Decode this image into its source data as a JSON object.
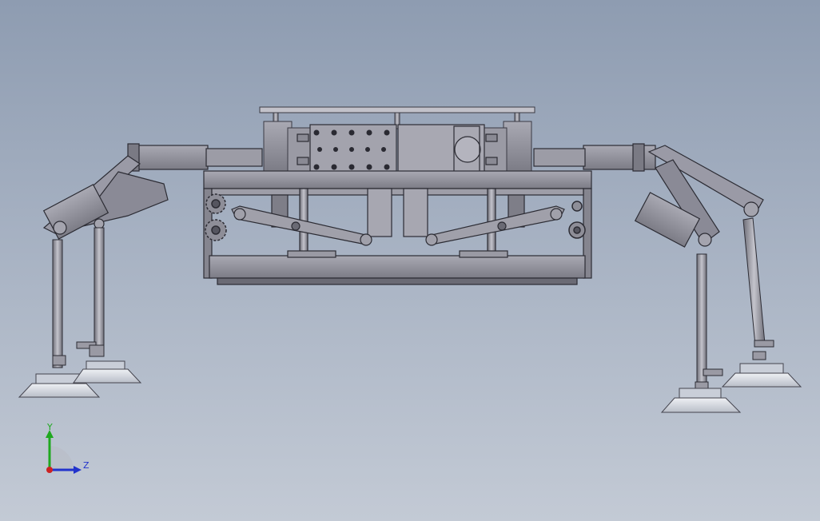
{
  "view": {
    "background_top": "#8e9cb1",
    "background_bottom": "#c3cad5"
  },
  "triad": {
    "y_label": "Y",
    "z_label": "Z",
    "y_color": "#1fa81f",
    "z_color": "#2233cc",
    "x_color": "#cc2222"
  },
  "model": {
    "metal_color": "#8c8c96",
    "dark_metal_color": "#5e5e68",
    "light_metal_color": "#b8b8c2",
    "suction_cup_color": "#d8dce4"
  }
}
